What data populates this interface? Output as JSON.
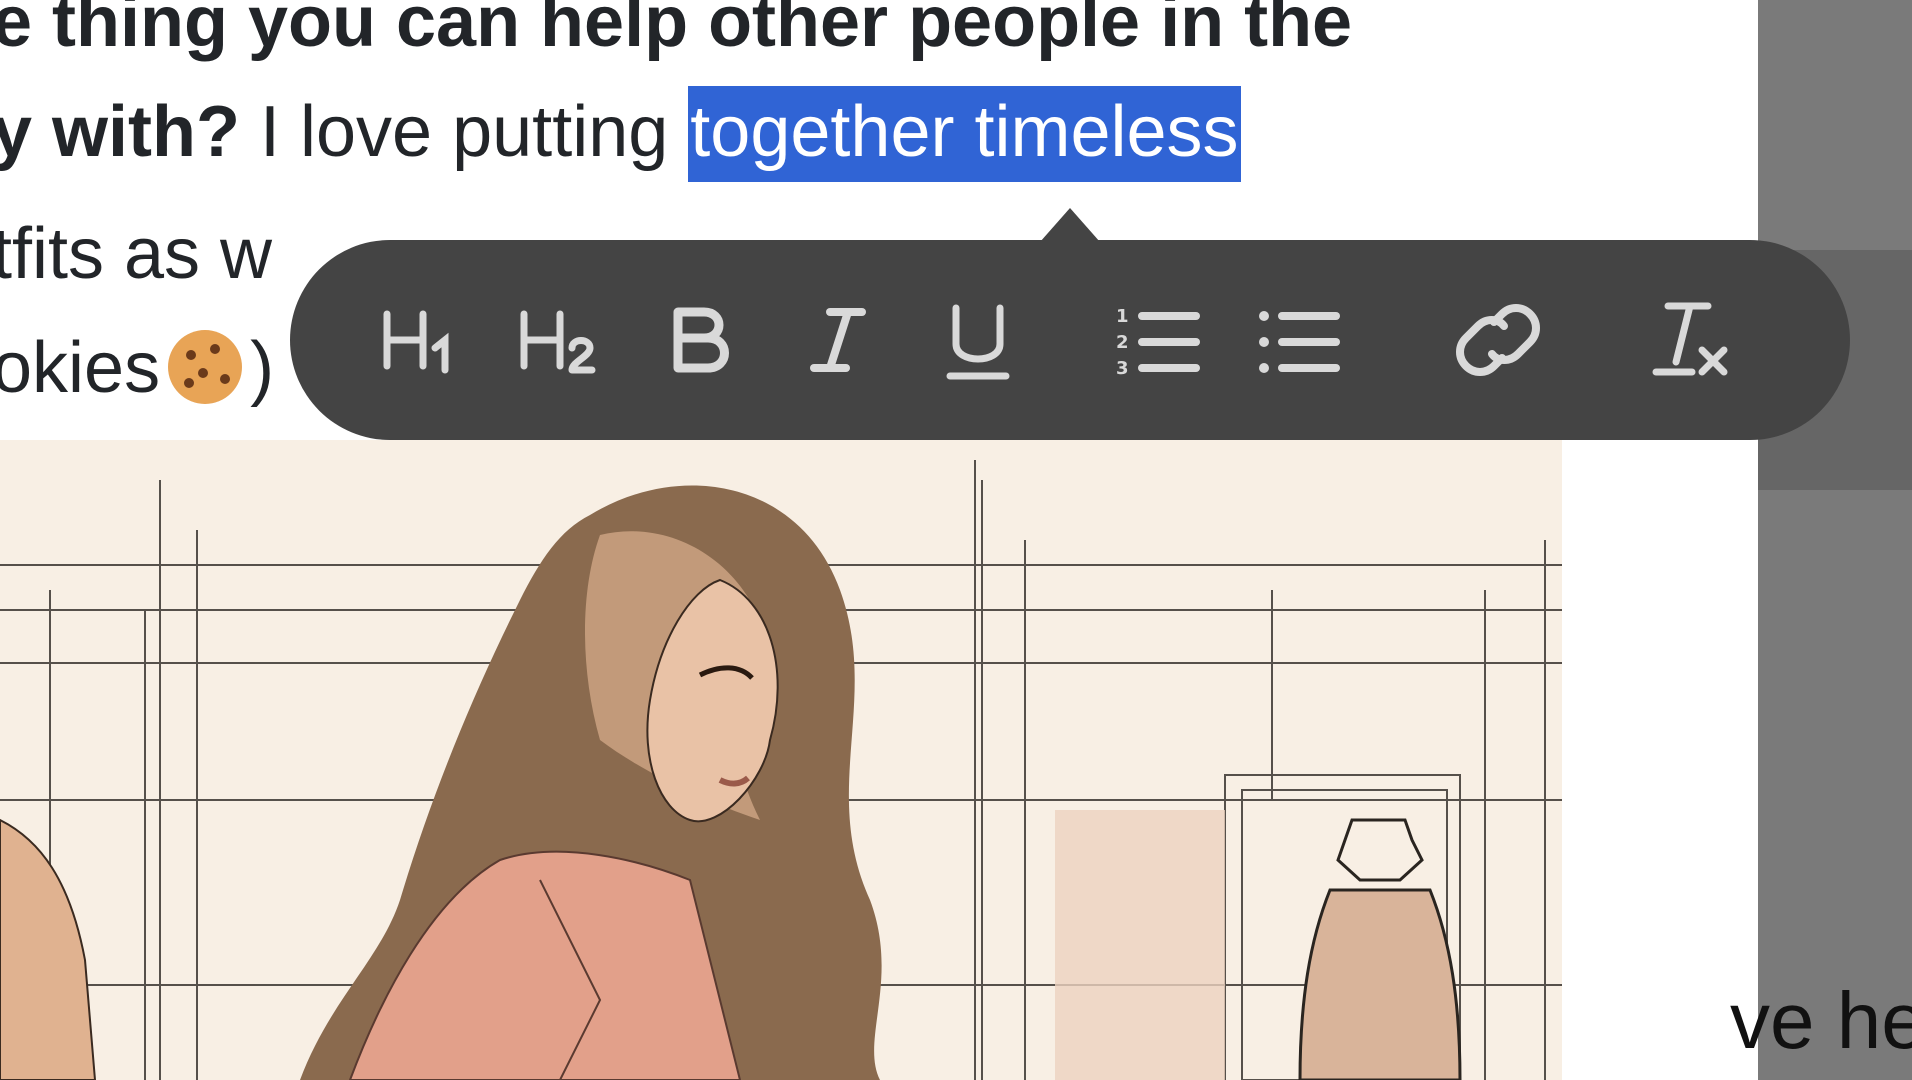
{
  "document": {
    "line1_bold": "e thing you can help other people in the",
    "line2_bold": "y with?",
    "line2_text": " I love putting ",
    "line2_selected": "together timeless",
    "line3_text": "tfits as w",
    "line4_text": "okies",
    "line4_after": ")"
  },
  "toolbar": {
    "buttons": [
      {
        "name": "heading-1-button",
        "icon": "heading-1-icon"
      },
      {
        "name": "heading-2-button",
        "icon": "heading-2-icon"
      },
      {
        "name": "bold-button",
        "icon": "bold-icon"
      },
      {
        "name": "italic-button",
        "icon": "italic-icon"
      },
      {
        "name": "underline-button",
        "icon": "underline-icon"
      },
      {
        "name": "ordered-list-button",
        "icon": "ordered-list-icon"
      },
      {
        "name": "bullet-list-button",
        "icon": "bullet-list-icon"
      },
      {
        "name": "link-button",
        "icon": "link-icon"
      },
      {
        "name": "clear-formatting-button",
        "icon": "clear-formatting-icon"
      }
    ]
  },
  "side": {
    "text": "ve he"
  },
  "colors": {
    "selection": "#3064d5",
    "toolbar": "#444444",
    "icon": "#d9d9d9"
  }
}
